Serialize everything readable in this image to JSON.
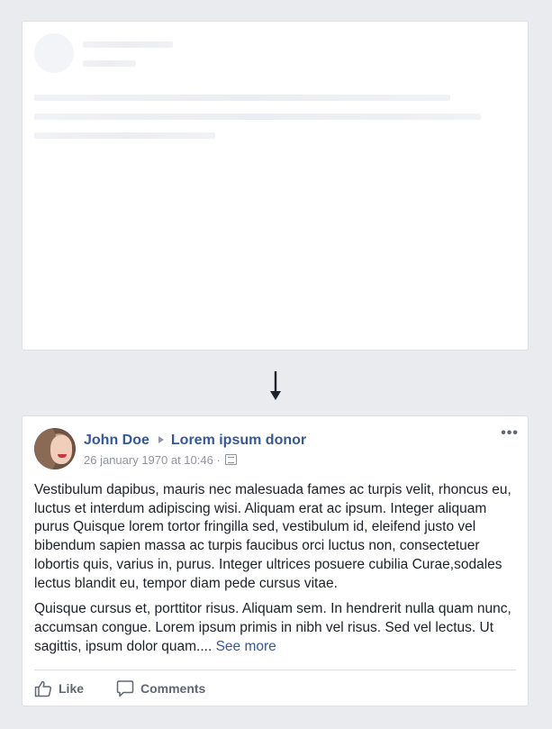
{
  "post": {
    "author": "John Doe",
    "target": "Lorem ipsum donor",
    "timestamp": "26 january 1970 at 10:46",
    "meta_separator": "·",
    "paragraph1": "Vestibulum dapibus, mauris nec malesuada fames ac turpis velit, rhoncus eu, luctus et interdum adipiscing wisi. Aliquam erat ac ipsum. Integer aliquam purus Quisque lorem tortor fringilla sed, vestibulum id, eleifend justo vel bibendum sapien massa ac turpis faucibus orci luctus non, consectetuer lobortis quis, varius in, purus. Integer ultrices posuere cubilia Curae,sodales lectus blandit eu, tempor diam pede cursus vitae.",
    "paragraph2": "Quisque cursus et, porttitor risus. Aliquam sem. In hendrerit nulla quam nunc, accumsan congue. Lorem ipsum primis in nibh vel risus. Sed vel lectus. Ut sagittis, ipsum dolor quam....",
    "see_more": "See more",
    "more_menu": "•••"
  },
  "actions": {
    "like": "Like",
    "comments": "Comments"
  },
  "icons": {
    "arrow": "arrow-down-icon",
    "like": "thumbs-up-icon",
    "comments": "comment-bubble-icon",
    "privacy": "audience-icon"
  },
  "colors": {
    "background": "#e9ebee",
    "link": "#365899",
    "text": "#1d2129",
    "muted": "#90949c"
  }
}
